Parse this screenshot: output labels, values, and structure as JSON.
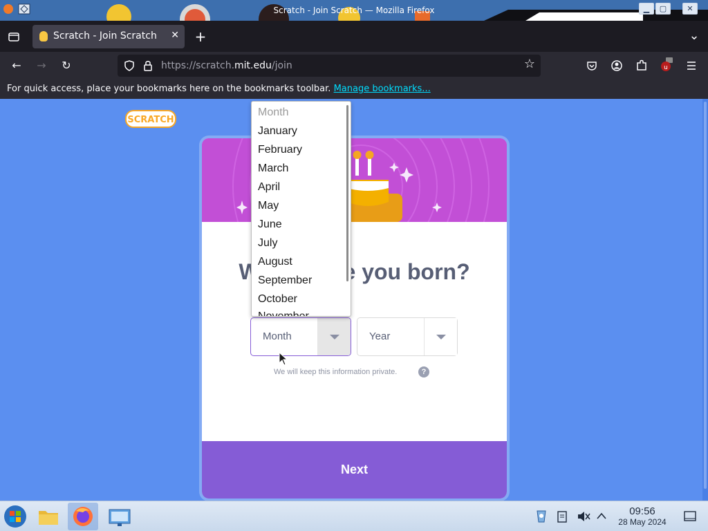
{
  "window": {
    "title": "Scratch - Join Scratch — Mozilla Firefox",
    "controls": [
      "minimize",
      "maximize",
      "close"
    ],
    "close_glyph": "✕",
    "minimize_glyph": "▁",
    "maximize_glyph": "▢"
  },
  "tabs": [
    {
      "label": "Scratch - Join Scratch",
      "active": true,
      "close_glyph": "✕"
    }
  ],
  "new_tab_glyph": "+",
  "tab_overflow_glyph": "⌄",
  "nav": {
    "back_glyph": "←",
    "forward_glyph": "→",
    "reload_glyph": "↻",
    "url_prefix": "https://scratch.",
    "url_domain": "mit.edu",
    "url_path": "/join",
    "bookmark_star_glyph": "☆"
  },
  "bookmarks_bar": {
    "message": "For quick access, place your bookmarks here on the bookmarks toolbar.",
    "link": "Manage bookmarks..."
  },
  "page": {
    "logo_text": "SCRATCH",
    "heading": "When were you born?",
    "month_select": {
      "value": "Month"
    },
    "year_select": {
      "value": "Year"
    },
    "privacy_text": "We will keep this information private.",
    "help_glyph": "?",
    "next_label": "Next"
  },
  "dropdown": {
    "options": [
      "Month",
      "January",
      "February",
      "March",
      "April",
      "May",
      "June",
      "July",
      "August",
      "September",
      "October",
      "November"
    ]
  },
  "taskbar": {
    "time": "09:56",
    "date": "28 May 2024"
  },
  "colors": {
    "page_bg": "#5b8ff0",
    "banner": "#c24fd6",
    "next_button": "#855cd6",
    "heading_text": "#575e75"
  }
}
